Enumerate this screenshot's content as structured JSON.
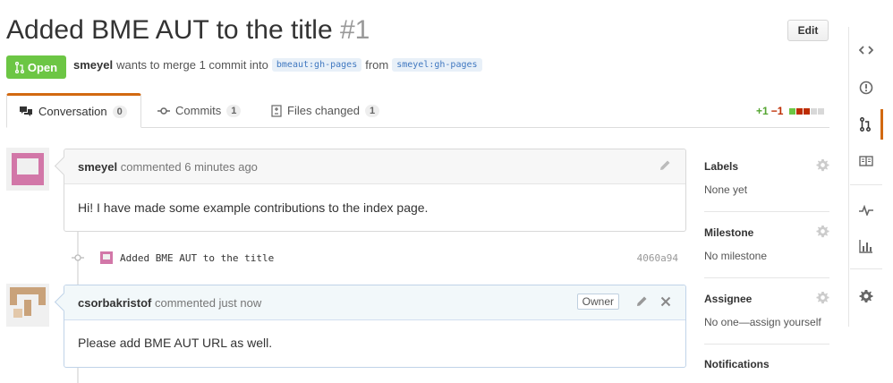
{
  "pr": {
    "title": "Added BME AUT to the title",
    "number": "#1",
    "edit_label": "Edit",
    "state": "Open",
    "author": "smeyel",
    "merge_text": "wants to merge 1 commit into",
    "base_owner": "bmeaut",
    "base_branch": "gh-pages",
    "from_text": "from",
    "head_owner": "smeyel",
    "head_branch": "gh-pages",
    "ref_sep": ":"
  },
  "tabs": [
    {
      "label": "Conversation",
      "count": "0",
      "icon": "comment-discussion-icon"
    },
    {
      "label": "Commits",
      "count": "1",
      "icon": "git-commit-icon"
    },
    {
      "label": "Files changed",
      "count": "1",
      "icon": "diff-icon"
    }
  ],
  "diffstat": {
    "additions": "+1",
    "deletions": "−1",
    "blocks": [
      "#6cc644",
      "#bd2c00",
      "#bd2c00",
      "#d8d8d8",
      "#d8d8d8"
    ]
  },
  "timeline": {
    "comment1": {
      "author": "smeyel",
      "action": "commented 6 minutes ago",
      "body": "Hi! I have made some example contributions to the index page."
    },
    "commit": {
      "message": "Added BME AUT to the title",
      "sha": "4060a94"
    },
    "comment2": {
      "author": "csorbakristof",
      "action": "commented just now",
      "badge": "Owner",
      "body": "Please add BME AUT URL as well."
    }
  },
  "sidebar": {
    "labels": {
      "title": "Labels",
      "value": "None yet"
    },
    "milestone": {
      "title": "Milestone",
      "value": "No milestone"
    },
    "assignee": {
      "title": "Assignee",
      "value": "No one—assign yourself"
    },
    "notifications": {
      "title": "Notifications"
    }
  },
  "rail": [
    "code-icon",
    "issue-opened-icon",
    "git-pull-request-icon",
    "book-icon",
    "pulse-icon",
    "graph-icon",
    "gear-icon"
  ],
  "colors": {
    "open": "#6cc644",
    "accent": "#d26911",
    "link": "#4078c0"
  }
}
